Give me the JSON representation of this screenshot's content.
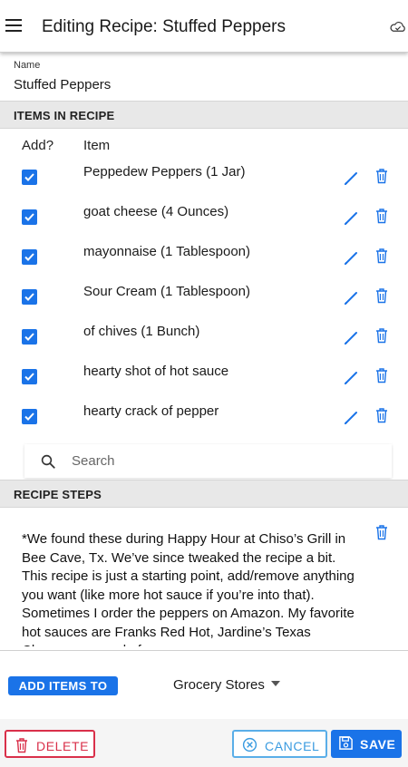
{
  "appbar": {
    "title": "Editing Recipe: Stuffed Peppers"
  },
  "name": {
    "label": "Name",
    "value": "Stuffed Peppers"
  },
  "items_section": {
    "header": "ITEMS IN RECIPE",
    "col_add": "Add?",
    "col_item": "Item",
    "items": [
      {
        "label": "Peppedew Peppers (1 Jar)",
        "checked": true
      },
      {
        "label": "goat cheese (4 Ounces)",
        "checked": true
      },
      {
        "label": "mayonnaise (1 Tablespoon)",
        "checked": true
      },
      {
        "label": "Sour Cream (1 Tablespoon)",
        "checked": true
      },
      {
        "label": "of chives (1 Bunch)",
        "checked": true
      },
      {
        "label": "hearty shot of hot sauce",
        "checked": true
      },
      {
        "label": "hearty crack of pepper",
        "checked": true
      }
    ]
  },
  "search": {
    "placeholder": "Search",
    "value": ""
  },
  "steps_section": {
    "header": "RECIPE STEPS",
    "text": "*We found these during Happy Hour at Chiso’s Grill in Bee Cave, Tx. We’ve since tweaked the recipe a bit. This recipe is just a starting point, add/remove anything you want (like more hot sauce if you’re into that). Sometimes I order the peppers on Amazon. My favorite hot sauces are Franks Red Hot, Jardine’s Texas Champagne, and of course,"
  },
  "bottom": {
    "add_items_label": "ADD ITEMS TO",
    "store_value": "Grocery Stores",
    "delete_label": "DELETE",
    "cancel_label": "CANCEL",
    "save_label": "SAVE"
  },
  "colors": {
    "accent": "#1a73e8",
    "danger": "#d9304a",
    "cancel": "#3a9be0",
    "header_bg": "#e8e8e8"
  },
  "icons": {
    "menu": "menu-icon",
    "cloud": "cloud-icon",
    "edit": "pencil-icon",
    "delete": "trash-icon",
    "search": "search-icon",
    "cancel": "cancel-circle-icon",
    "save": "floppy-icon"
  }
}
